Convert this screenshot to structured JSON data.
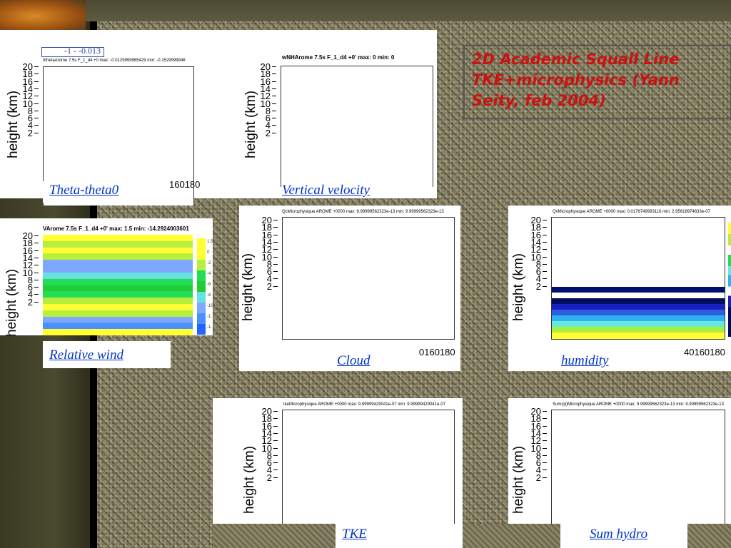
{
  "slide": {
    "headline": "2D Academic Squall Line TKE+microphysics (Yann Seity, feb 2004)"
  },
  "yaxis": {
    "label": "height (km)",
    "ticks": [
      "20",
      "18",
      "16",
      "14",
      "12",
      "10",
      "8",
      "6",
      "4",
      "2"
    ]
  },
  "plots": {
    "theta": {
      "title": "0thetaArome 7.5s F_1_d4 +0  max: -0.0129999965429 min: -0.1529999946",
      "annotation": "-1 - -0.013",
      "xticks": "160180",
      "caption": "Theta-theta0"
    },
    "vertical": {
      "title": "wNHArome 7.5s F_1_d4 +0' max: 0 min: 0",
      "caption": "Vertical velocity"
    },
    "relwind": {
      "title": "VArome 7.5s F_1_d4 +0' max: 1.5 min: -14.2924003601",
      "cbar_labels": [
        "1.5",
        "0",
        "-2",
        "-4",
        "-6",
        "-8",
        "-10",
        "-1.",
        "-1."
      ],
      "bands": [
        "#ffff33",
        "#b7ef3c",
        "#ffff33",
        "#b7ef3c",
        "#7ea8ff",
        "#7ea8ff",
        "#66e0e0",
        "#22dd55",
        "#22cc33",
        "#22dd55",
        "#b7ef3c",
        "#ffff33",
        "#b7ef3c",
        "#7ea8ff",
        "#4a90ff",
        "#ffff33"
      ],
      "caption": "Relative wind"
    },
    "cloud": {
      "title": "QcMicrophysique AROME +0000 max: 9.99999562323e-13 min: 9.99999562323e-13",
      "xticks": "0160180",
      "caption": "Cloud"
    },
    "humidity": {
      "title": "QvMicrophysique AROME +0000 max: 0.0176749993116 min: 2.95618974633e-07",
      "xticks": "40160180",
      "bands": [
        "#001070",
        "#ffffff",
        "#000c60",
        "#1a20c0",
        "#2a60e0",
        "#30b0f0",
        "#66e8e0",
        "#a8ef40",
        "#ffff33"
      ],
      "caption": "humidity"
    },
    "tke": {
      "title": "tkeMicrophysique AROME +0000 max: 9.99999429041e-07 min: 9.99999429041e-07",
      "caption": "TKE"
    },
    "sumhydro": {
      "title": "Sum(qi)Microphysique AROME +0000 max: 9.99999562323e-13 min: 9.99999562323e-13",
      "caption": "Sum hydro"
    }
  },
  "colors": {
    "caption": "#0033cc",
    "headline": "#cc1111"
  }
}
